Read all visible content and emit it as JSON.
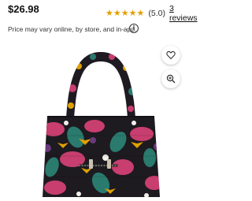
{
  "product": {
    "price": "$26.98",
    "rating": {
      "stars": 5,
      "value_label": "(5.0)",
      "reviews_label": "3 reviews"
    },
    "price_note": "Price may vary online, by store, and in-app.",
    "info_icon": "i"
  },
  "image": {
    "description_icon": "floral-quilted-tote-bag-image",
    "accent_color": "#e0a000"
  },
  "actions": {
    "favorite_icon": "heart-icon",
    "zoom_icon": "zoom-in-icon"
  }
}
